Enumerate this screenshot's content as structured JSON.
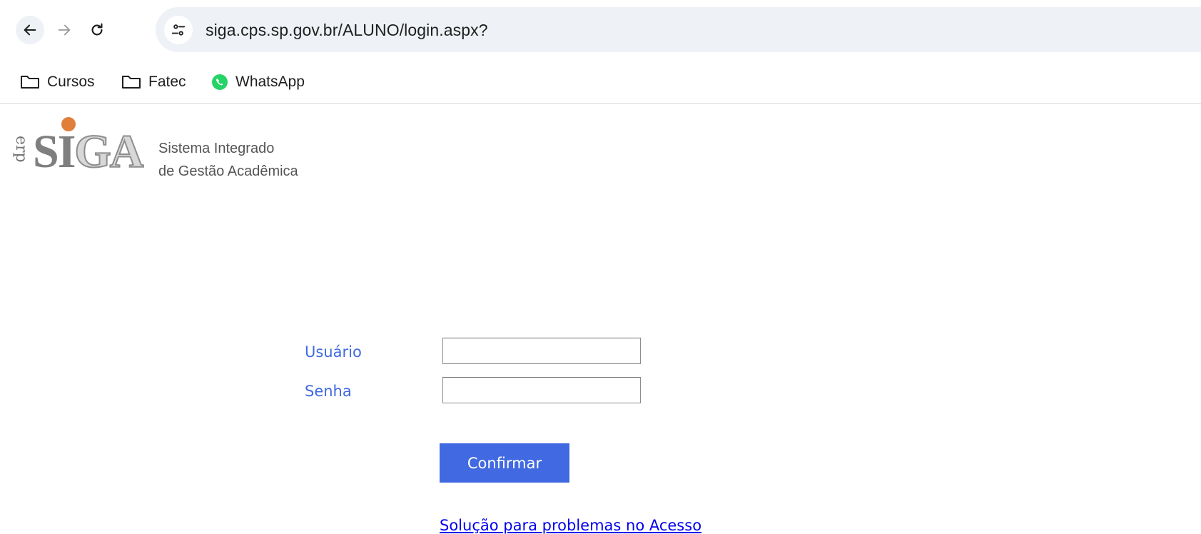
{
  "browser": {
    "url": "siga.cps.sp.gov.br/ALUNO/login.aspx?",
    "nav": {
      "back_icon": "arrow-left-icon",
      "forward_icon": "arrow-right-icon",
      "reload_icon": "reload-icon",
      "site_info_icon": "tune-icon"
    },
    "bookmarks": [
      {
        "label": "Cursos",
        "icon": "folder-icon"
      },
      {
        "label": "Fatec",
        "icon": "folder-icon"
      },
      {
        "label": "WhatsApp",
        "icon": "whatsapp-icon"
      }
    ]
  },
  "logo": {
    "erp": "erp",
    "word_si": "SI",
    "word_ga": "GA",
    "tagline_line1": "Sistema Integrado",
    "tagline_line2": "de Gestão Acadêmica"
  },
  "login": {
    "user_label": "Usuário",
    "user_value": "",
    "password_label": "Senha",
    "password_value": "",
    "confirm_label": "Confirmar",
    "help_link": "Solução para problemas no Acesso"
  },
  "colors": {
    "accent": "#4169e1",
    "link": "#0000ee",
    "logo_dot": "#e07f3a",
    "whatsapp": "#25d366"
  }
}
